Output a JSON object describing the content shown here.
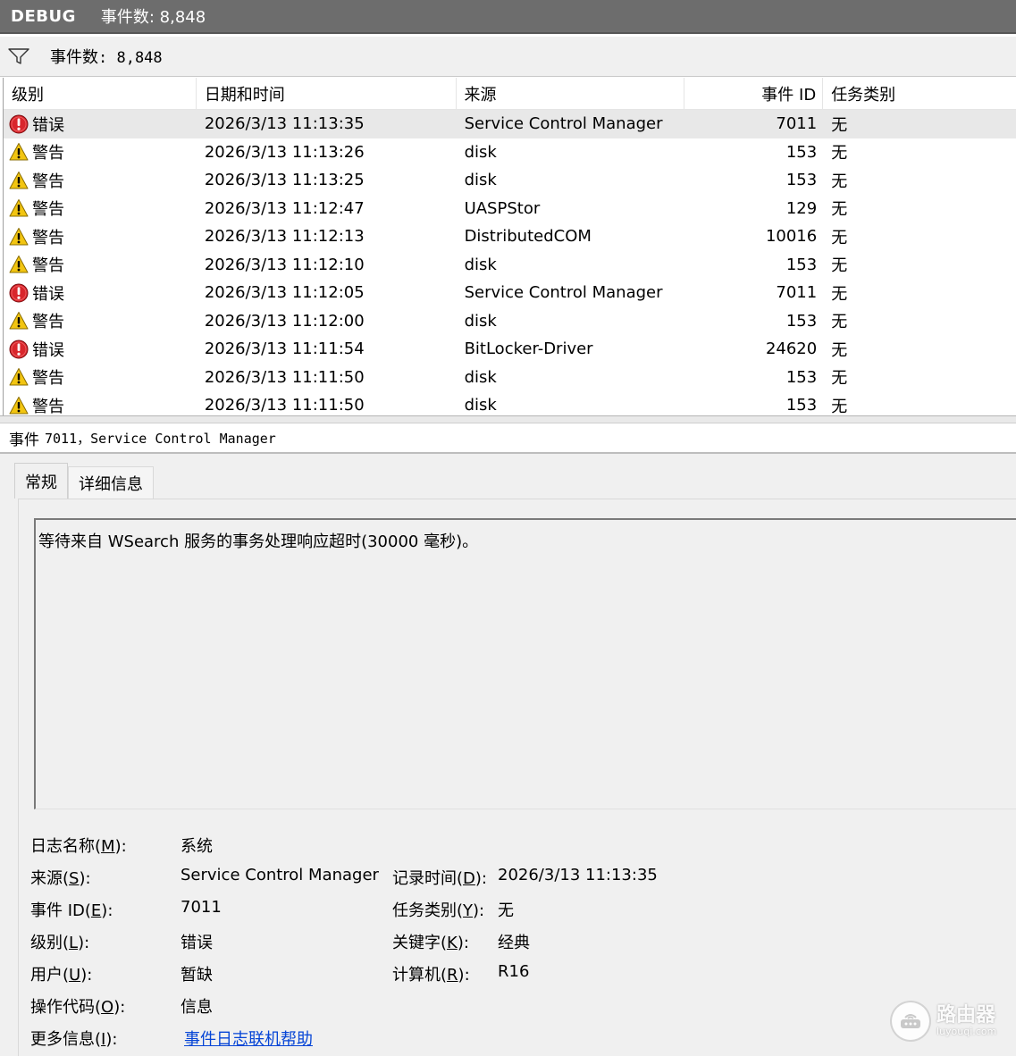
{
  "titlebar": {
    "app": "DEBUG",
    "count": "事件数: 8,848"
  },
  "filterbar": {
    "label": "事件数",
    "value": ": 8,848"
  },
  "columns": {
    "level": "级别",
    "date": "日期和时间",
    "source": "来源",
    "id": "事件 ID",
    "task": "任务类别"
  },
  "rows": [
    {
      "level": "错误",
      "type": "error",
      "date": "2026/3/13 11:13:35",
      "source": "Service Control Manager",
      "id": "7011",
      "task": "无"
    },
    {
      "level": "警告",
      "type": "warning",
      "date": "2026/3/13 11:13:26",
      "source": "disk",
      "id": "153",
      "task": "无"
    },
    {
      "level": "警告",
      "type": "warning",
      "date": "2026/3/13 11:13:25",
      "source": "disk",
      "id": "153",
      "task": "无"
    },
    {
      "level": "警告",
      "type": "warning",
      "date": "2026/3/13 11:12:47",
      "source": "UASPStor",
      "id": "129",
      "task": "无"
    },
    {
      "level": "警告",
      "type": "warning",
      "date": "2026/3/13 11:12:13",
      "source": "DistributedCOM",
      "id": "10016",
      "task": "无"
    },
    {
      "level": "警告",
      "type": "warning",
      "date": "2026/3/13 11:12:10",
      "source": "disk",
      "id": "153",
      "task": "无"
    },
    {
      "level": "错误",
      "type": "error",
      "date": "2026/3/13 11:12:05",
      "source": "Service Control Manager",
      "id": "7011",
      "task": "无"
    },
    {
      "level": "警告",
      "type": "warning",
      "date": "2026/3/13 11:12:00",
      "source": "disk",
      "id": "153",
      "task": "无"
    },
    {
      "level": "错误",
      "type": "error",
      "date": "2026/3/13 11:11:54",
      "source": "BitLocker-Driver",
      "id": "24620",
      "task": "无"
    },
    {
      "level": "警告",
      "type": "warning",
      "date": "2026/3/13 11:11:50",
      "source": "disk",
      "id": "153",
      "task": "无"
    },
    {
      "level": "警告",
      "type": "warning",
      "date": "2026/3/13 11:11:50",
      "source": "disk",
      "id": "153",
      "task": "无"
    }
  ],
  "detail": {
    "title_prefix": "事件",
    "title_rest": "7011，Service Control Manager",
    "tabs": [
      "常规",
      "详细信息"
    ],
    "message": "等待来自 WSearch 服务的事务处理响应超时(30000 毫秒)。",
    "props": {
      "log_name_label": "日志名称(",
      "log_name_key": "M",
      "log_name_end": "):",
      "log_name": "系统",
      "source_label": "来源(",
      "source_key": "S",
      "source_end": "):",
      "source": "Service Control Manager",
      "logged_label": "记录时间(",
      "logged_key": "D",
      "logged_end": "):",
      "logged": "2026/3/13 11:13:35",
      "id_label": "事件 ID(",
      "id_key": "E",
      "id_end": "):",
      "id": "7011",
      "task_label": "任务类别(",
      "task_key": "Y",
      "task_end": "):",
      "task": "无",
      "level_label": "级别(",
      "level_key": "L",
      "level_end": "):",
      "level": "错误",
      "keywords_label": "关键字(",
      "keywords_key": "K",
      "keywords_end": "):",
      "keywords": "经典",
      "user_label": "用户(",
      "user_key": "U",
      "user_end": "):",
      "user": "暂缺",
      "computer_label": "计算机(",
      "computer_key": "R",
      "computer_end": "):",
      "computer": "R16",
      "opcode_label": "操作代码(",
      "opcode_key": "O",
      "opcode_end": "):",
      "opcode": "信息",
      "more_label": "更多信息(",
      "more_key": "I",
      "more_end": "):",
      "more_link": "事件日志联机帮助"
    }
  },
  "watermark": {
    "brand": "路由器",
    "url": "luyouqi.com"
  },
  "colors": {
    "error": "#d9262c",
    "warning": "#f2c511",
    "link": "#0645d6",
    "titlebar": "#6d6d6d"
  }
}
